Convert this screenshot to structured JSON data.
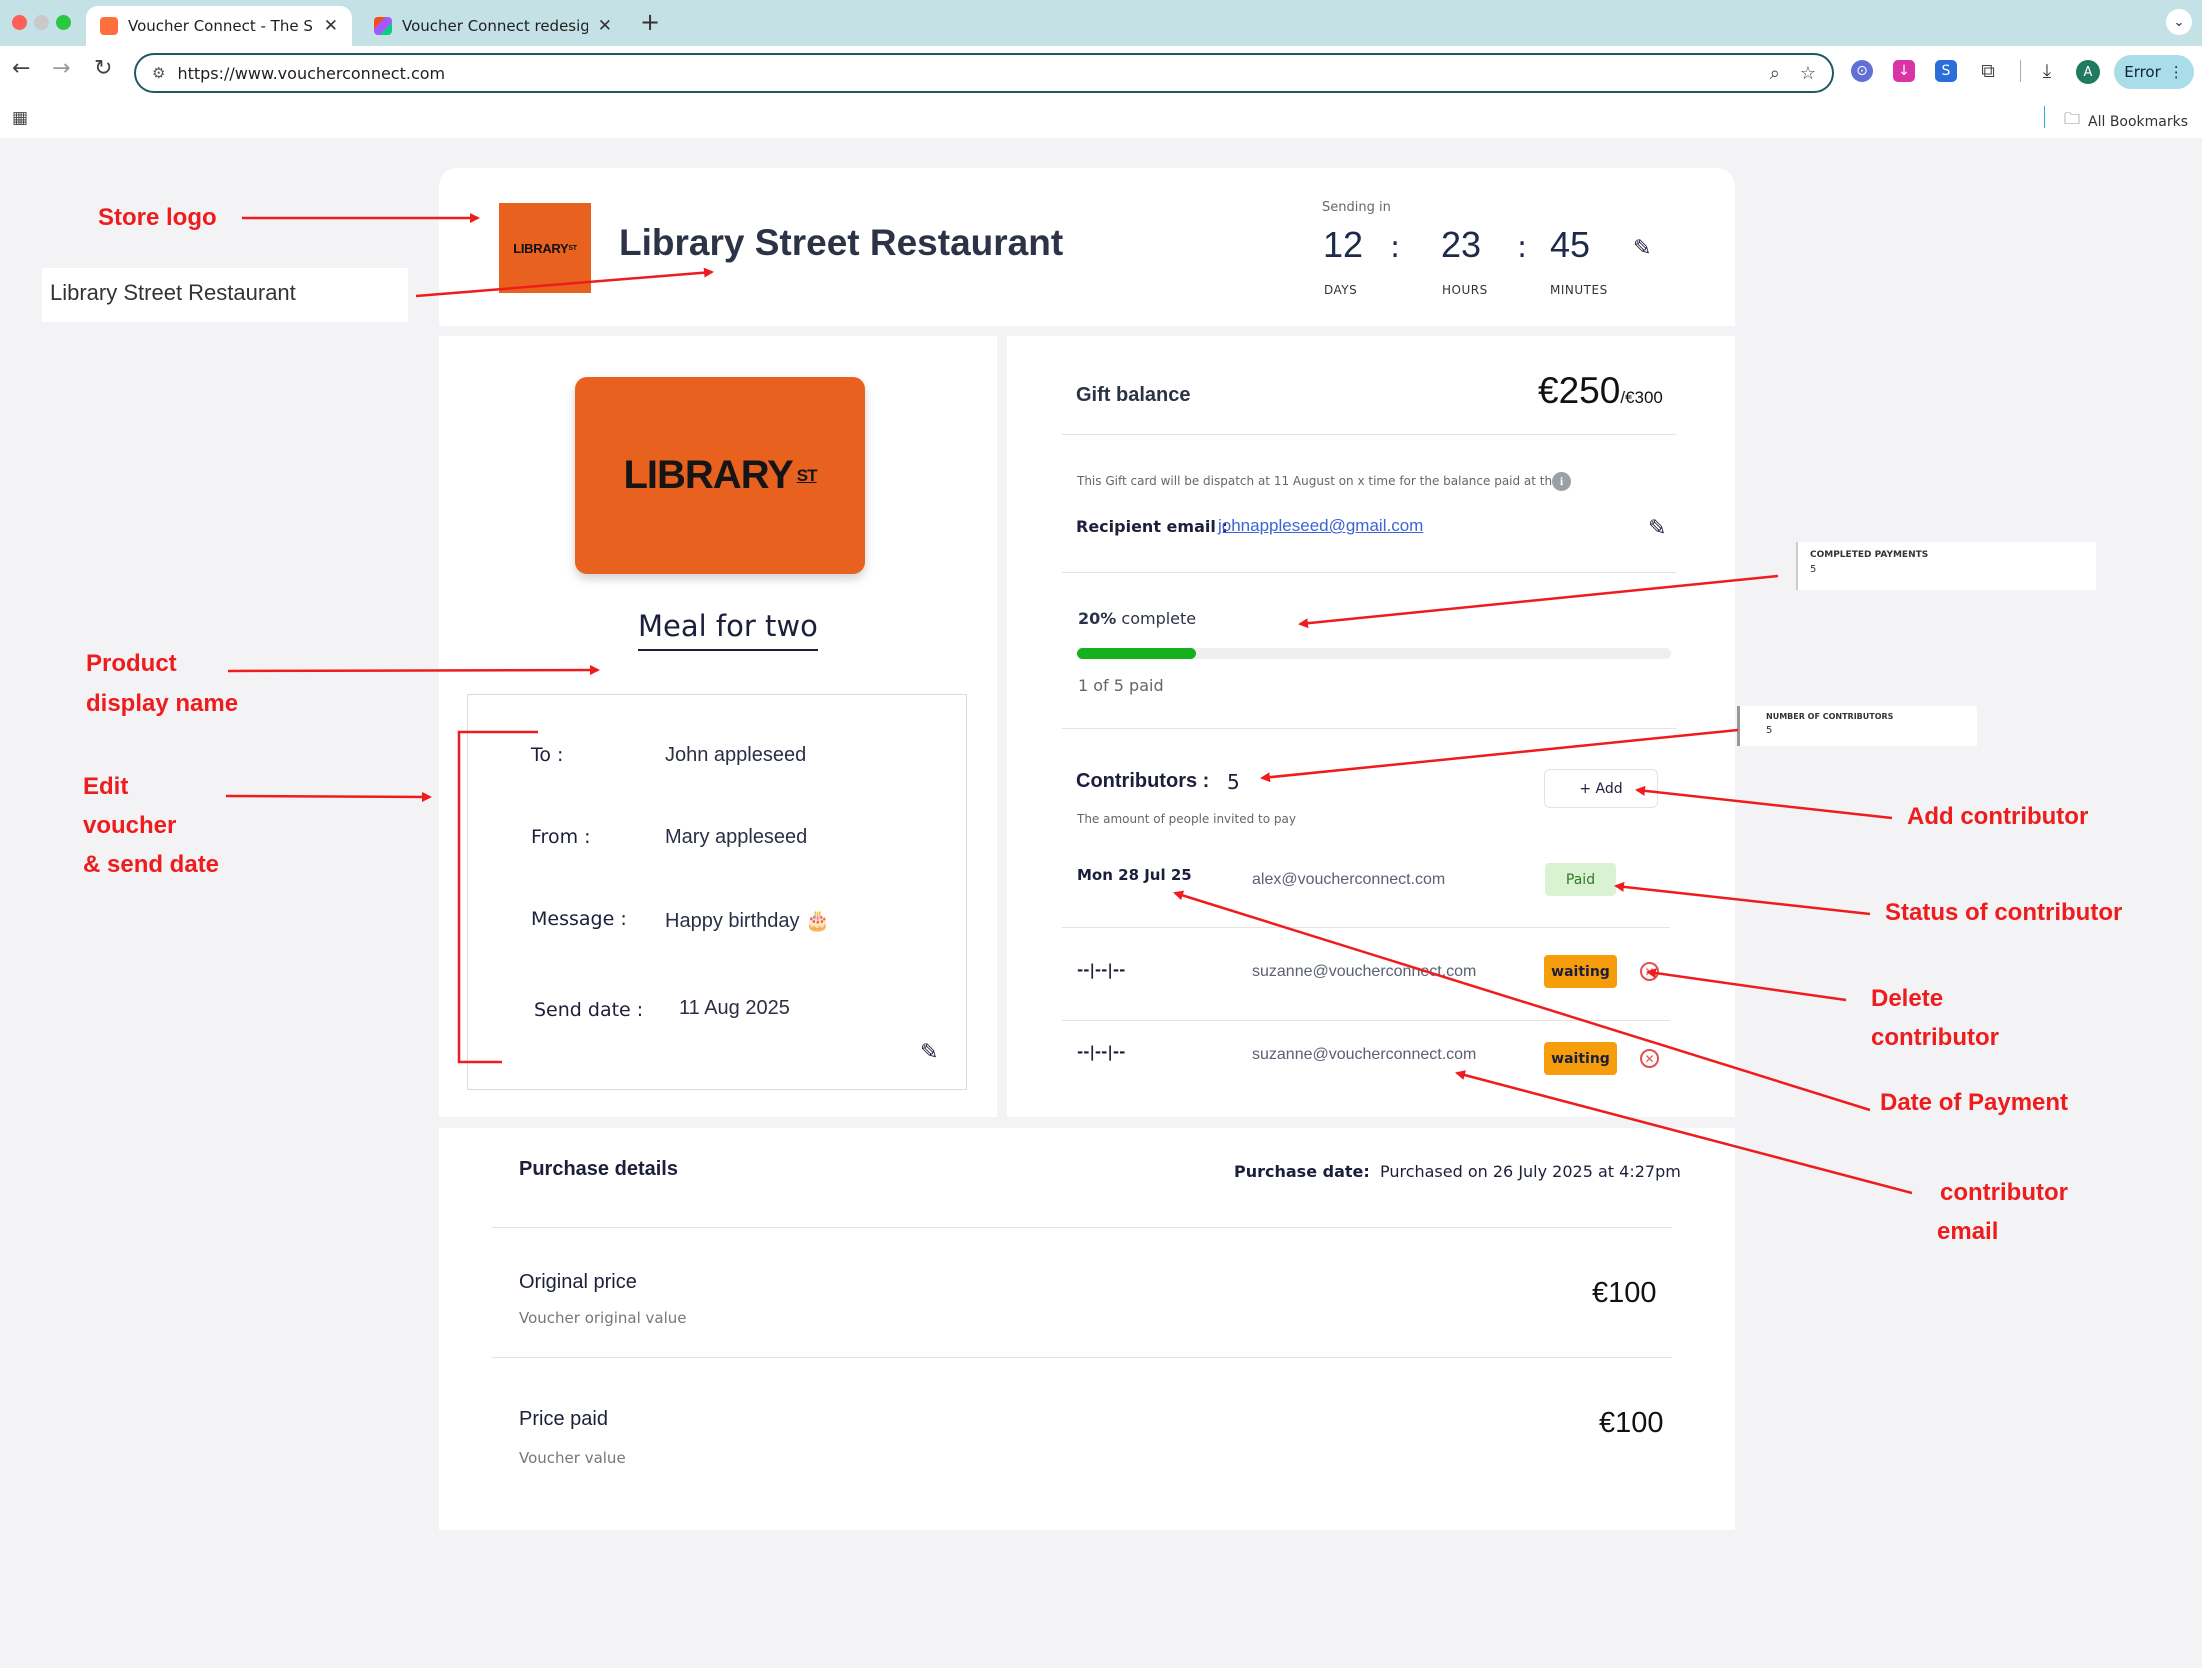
{
  "browser": {
    "tabs": [
      {
        "title": "Voucher Connect - The Smar"
      },
      {
        "title": "Voucher Connect redesign – I"
      }
    ],
    "url": "https://www.voucherconnect.com",
    "profile_initial": "A",
    "error_label": "Error",
    "bookmarks_label": "All Bookmarks"
  },
  "header": {
    "logo_text": "LIBRARY",
    "logo_sup": "ST",
    "store_name": "Library Street Restaurant",
    "sending_label": "Sending in",
    "countdown": {
      "days": "12",
      "days_label": "DAYS",
      "hours": "23",
      "hours_label": "HOURS",
      "minutes": "45",
      "minutes_label": "MINUTES"
    }
  },
  "voucher": {
    "card_text": "LIBRARY",
    "card_sup": "ST",
    "product_name": "Meal for two",
    "to_label": "To :",
    "to_value": "John appleseed",
    "from_label": "From :",
    "from_value": "Mary appleseed",
    "message_label": "Message :",
    "message_value": "Happy birthday 🎂",
    "send_date_label": "Send date :",
    "send_date_value": "11 Aug 2025"
  },
  "gift": {
    "title": "Gift balance",
    "amount": "€250",
    "total": "/€300",
    "dispatch_note": "This Gift card will be dispatch at 11 August on x time for the balance paid at that.",
    "recipient_label": "Recipient email :",
    "recipient_email": "johnappleseed@gmail.com",
    "percent_bold": "20%",
    "percent_text": "complete",
    "progress": 0.2,
    "paid_text": "1 of 5 paid"
  },
  "contributors": {
    "title": "Contributors :",
    "count": "5",
    "subtitle": "The amount of people invited to pay",
    "add_label": "+ Add",
    "rows": [
      {
        "date": "Mon 28 Jul 25",
        "email": "alex@voucherconnect.com",
        "status": "Paid"
      },
      {
        "date": "--|--|--",
        "email": "suzanne@voucherconnect.com",
        "status": "waiting"
      },
      {
        "date": "--|--|--",
        "email": "suzanne@voucherconnect.com",
        "status": "waiting"
      }
    ]
  },
  "purchase": {
    "title": "Purchase details",
    "date_label": "Purchase date:",
    "date_value": "Purchased on 26 July 2025 at 4:27pm",
    "original_title": "Original price",
    "original_sub": "Voucher original value",
    "original_price": "€100",
    "paid_title": "Price paid",
    "paid_sub": "Voucher value",
    "paid_price": "€100"
  },
  "annotations": {
    "store_logo": "Store logo",
    "store_name_box": "Library Street Restaurant",
    "product_display_1": "Product",
    "product_display_2": "display name",
    "edit_1": "Edit",
    "edit_2": "voucher",
    "edit_3": "& send date",
    "completed_payments_title": "COMPLETED PAYMENTS",
    "completed_payments_value": "5",
    "num_contributors_title": "NUMBER OF CONTRIBUTORS",
    "num_contributors_value": "5",
    "add_contributor": "Add contributor",
    "status_contributor": "Status of contributor",
    "delete_1": "Delete",
    "delete_2": "contributor",
    "date_of_payment": "Date of Payment",
    "contrib_email_1": "contributor",
    "contrib_email_2": "email"
  },
  "colors": {
    "brand_orange": "#e8611f",
    "progress_green": "#14b11d",
    "waiting_orange": "#f59d0b",
    "annotation_red": "#ee1c1c"
  }
}
